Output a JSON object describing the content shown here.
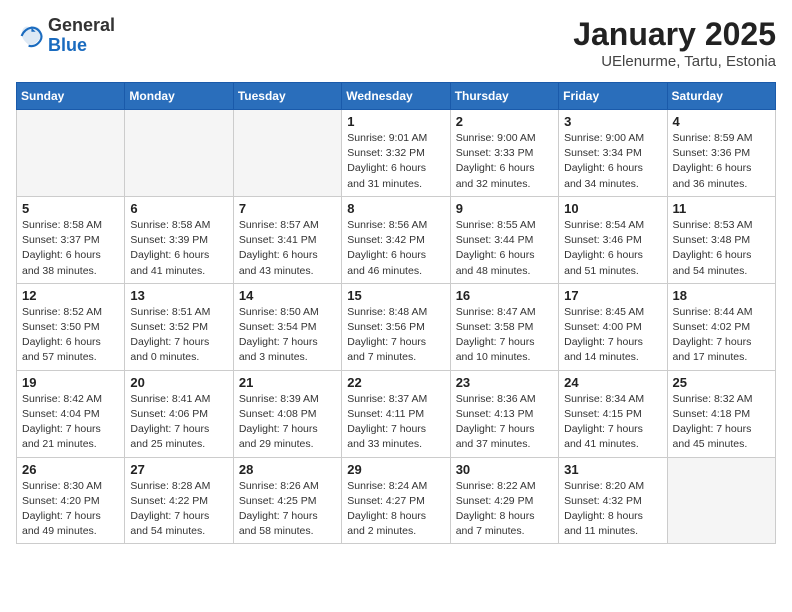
{
  "header": {
    "logo_general": "General",
    "logo_blue": "Blue",
    "title": "January 2025",
    "subtitle": "UElenurme, Tartu, Estonia"
  },
  "days_of_week": [
    "Sunday",
    "Monday",
    "Tuesday",
    "Wednesday",
    "Thursday",
    "Friday",
    "Saturday"
  ],
  "weeks": [
    [
      {
        "day": "",
        "empty": true
      },
      {
        "day": "",
        "empty": true
      },
      {
        "day": "",
        "empty": true
      },
      {
        "day": "1",
        "sunrise": "Sunrise: 9:01 AM",
        "sunset": "Sunset: 3:32 PM",
        "daylight": "Daylight: 6 hours and 31 minutes."
      },
      {
        "day": "2",
        "sunrise": "Sunrise: 9:00 AM",
        "sunset": "Sunset: 3:33 PM",
        "daylight": "Daylight: 6 hours and 32 minutes."
      },
      {
        "day": "3",
        "sunrise": "Sunrise: 9:00 AM",
        "sunset": "Sunset: 3:34 PM",
        "daylight": "Daylight: 6 hours and 34 minutes."
      },
      {
        "day": "4",
        "sunrise": "Sunrise: 8:59 AM",
        "sunset": "Sunset: 3:36 PM",
        "daylight": "Daylight: 6 hours and 36 minutes."
      }
    ],
    [
      {
        "day": "5",
        "sunrise": "Sunrise: 8:58 AM",
        "sunset": "Sunset: 3:37 PM",
        "daylight": "Daylight: 6 hours and 38 minutes."
      },
      {
        "day": "6",
        "sunrise": "Sunrise: 8:58 AM",
        "sunset": "Sunset: 3:39 PM",
        "daylight": "Daylight: 6 hours and 41 minutes."
      },
      {
        "day": "7",
        "sunrise": "Sunrise: 8:57 AM",
        "sunset": "Sunset: 3:41 PM",
        "daylight": "Daylight: 6 hours and 43 minutes."
      },
      {
        "day": "8",
        "sunrise": "Sunrise: 8:56 AM",
        "sunset": "Sunset: 3:42 PM",
        "daylight": "Daylight: 6 hours and 46 minutes."
      },
      {
        "day": "9",
        "sunrise": "Sunrise: 8:55 AM",
        "sunset": "Sunset: 3:44 PM",
        "daylight": "Daylight: 6 hours and 48 minutes."
      },
      {
        "day": "10",
        "sunrise": "Sunrise: 8:54 AM",
        "sunset": "Sunset: 3:46 PM",
        "daylight": "Daylight: 6 hours and 51 minutes."
      },
      {
        "day": "11",
        "sunrise": "Sunrise: 8:53 AM",
        "sunset": "Sunset: 3:48 PM",
        "daylight": "Daylight: 6 hours and 54 minutes."
      }
    ],
    [
      {
        "day": "12",
        "sunrise": "Sunrise: 8:52 AM",
        "sunset": "Sunset: 3:50 PM",
        "daylight": "Daylight: 6 hours and 57 minutes."
      },
      {
        "day": "13",
        "sunrise": "Sunrise: 8:51 AM",
        "sunset": "Sunset: 3:52 PM",
        "daylight": "Daylight: 7 hours and 0 minutes."
      },
      {
        "day": "14",
        "sunrise": "Sunrise: 8:50 AM",
        "sunset": "Sunset: 3:54 PM",
        "daylight": "Daylight: 7 hours and 3 minutes."
      },
      {
        "day": "15",
        "sunrise": "Sunrise: 8:48 AM",
        "sunset": "Sunset: 3:56 PM",
        "daylight": "Daylight: 7 hours and 7 minutes."
      },
      {
        "day": "16",
        "sunrise": "Sunrise: 8:47 AM",
        "sunset": "Sunset: 3:58 PM",
        "daylight": "Daylight: 7 hours and 10 minutes."
      },
      {
        "day": "17",
        "sunrise": "Sunrise: 8:45 AM",
        "sunset": "Sunset: 4:00 PM",
        "daylight": "Daylight: 7 hours and 14 minutes."
      },
      {
        "day": "18",
        "sunrise": "Sunrise: 8:44 AM",
        "sunset": "Sunset: 4:02 PM",
        "daylight": "Daylight: 7 hours and 17 minutes."
      }
    ],
    [
      {
        "day": "19",
        "sunrise": "Sunrise: 8:42 AM",
        "sunset": "Sunset: 4:04 PM",
        "daylight": "Daylight: 7 hours and 21 minutes."
      },
      {
        "day": "20",
        "sunrise": "Sunrise: 8:41 AM",
        "sunset": "Sunset: 4:06 PM",
        "daylight": "Daylight: 7 hours and 25 minutes."
      },
      {
        "day": "21",
        "sunrise": "Sunrise: 8:39 AM",
        "sunset": "Sunset: 4:08 PM",
        "daylight": "Daylight: 7 hours and 29 minutes."
      },
      {
        "day": "22",
        "sunrise": "Sunrise: 8:37 AM",
        "sunset": "Sunset: 4:11 PM",
        "daylight": "Daylight: 7 hours and 33 minutes."
      },
      {
        "day": "23",
        "sunrise": "Sunrise: 8:36 AM",
        "sunset": "Sunset: 4:13 PM",
        "daylight": "Daylight: 7 hours and 37 minutes."
      },
      {
        "day": "24",
        "sunrise": "Sunrise: 8:34 AM",
        "sunset": "Sunset: 4:15 PM",
        "daylight": "Daylight: 7 hours and 41 minutes."
      },
      {
        "day": "25",
        "sunrise": "Sunrise: 8:32 AM",
        "sunset": "Sunset: 4:18 PM",
        "daylight": "Daylight: 7 hours and 45 minutes."
      }
    ],
    [
      {
        "day": "26",
        "sunrise": "Sunrise: 8:30 AM",
        "sunset": "Sunset: 4:20 PM",
        "daylight": "Daylight: 7 hours and 49 minutes."
      },
      {
        "day": "27",
        "sunrise": "Sunrise: 8:28 AM",
        "sunset": "Sunset: 4:22 PM",
        "daylight": "Daylight: 7 hours and 54 minutes."
      },
      {
        "day": "28",
        "sunrise": "Sunrise: 8:26 AM",
        "sunset": "Sunset: 4:25 PM",
        "daylight": "Daylight: 7 hours and 58 minutes."
      },
      {
        "day": "29",
        "sunrise": "Sunrise: 8:24 AM",
        "sunset": "Sunset: 4:27 PM",
        "daylight": "Daylight: 8 hours and 2 minutes."
      },
      {
        "day": "30",
        "sunrise": "Sunrise: 8:22 AM",
        "sunset": "Sunset: 4:29 PM",
        "daylight": "Daylight: 8 hours and 7 minutes."
      },
      {
        "day": "31",
        "sunrise": "Sunrise: 8:20 AM",
        "sunset": "Sunset: 4:32 PM",
        "daylight": "Daylight: 8 hours and 11 minutes."
      },
      {
        "day": "",
        "empty": true
      }
    ]
  ]
}
